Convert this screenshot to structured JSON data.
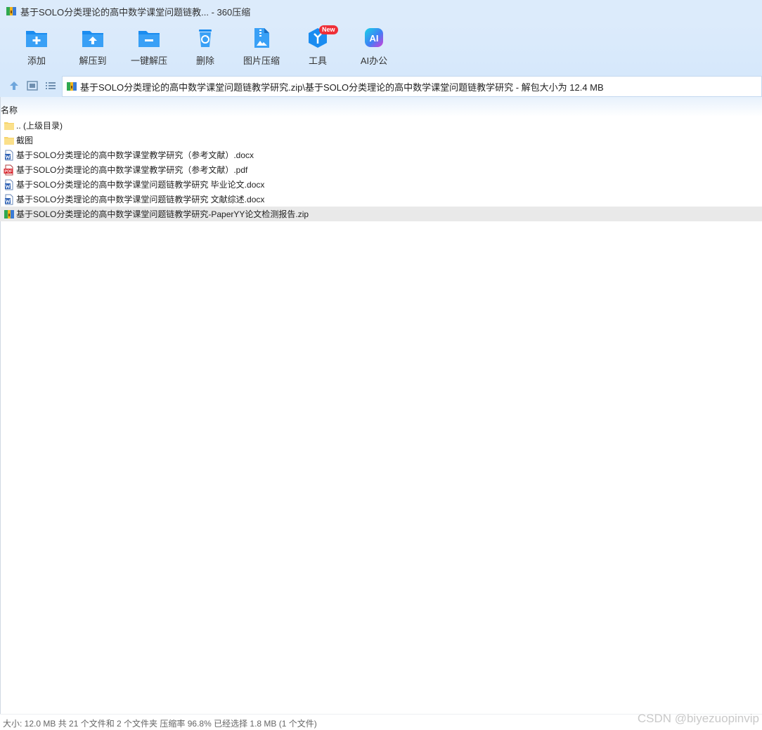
{
  "window": {
    "title": "基于SOLO分类理论的高中数学课堂问题链教... - 360压缩"
  },
  "toolbar": {
    "buttons": [
      {
        "label": "添加",
        "icon": "add-icon"
      },
      {
        "label": "解压到",
        "icon": "extract-to-icon"
      },
      {
        "label": "一键解压",
        "icon": "one-click-extract-icon"
      },
      {
        "label": "删除",
        "icon": "recycle-bin-icon"
      },
      {
        "label": "图片压缩",
        "icon": "image-compress-icon"
      },
      {
        "label": "工具",
        "icon": "tools-icon",
        "badge": "New"
      },
      {
        "label": "AI办公",
        "icon": "ai-office-icon",
        "icon_text": "AI"
      }
    ]
  },
  "nav": {
    "address": "基于SOLO分类理论的高中数学课堂问题链教学研究.zip\\基于SOLO分类理论的高中数学课堂问题链教学研究 - 解包大小为 12.4 MB"
  },
  "columns": {
    "name": "名称"
  },
  "files": [
    {
      "name": ".. (上级目录)",
      "type": "folder"
    },
    {
      "name": "截图",
      "type": "folder"
    },
    {
      "name": "基于SOLO分类理论的高中数学课堂教学研究（参考文献）.docx",
      "type": "word"
    },
    {
      "name": "基于SOLO分类理论的高中数学课堂教学研究（参考文献）.pdf",
      "type": "pdf",
      "icon_text": "PDF"
    },
    {
      "name": "基于SOLO分类理论的高中数学课堂问题链教学研究 毕业论文.docx",
      "type": "word"
    },
    {
      "name": "基于SOLO分类理论的高中数学课堂问题链教学研究 文献综述.docx",
      "type": "word"
    },
    {
      "name": "基于SOLO分类理论的高中数学课堂问题链教学研究-PaperYY论文检测报告.zip",
      "type": "zip",
      "selected": true
    }
  ],
  "status": {
    "text": "大小: 12.0 MB 共 21 个文件和 2 个文件夹 压缩率 96.8% 已经选择 1.8 MB (1 个文件)"
  },
  "watermark": "CSDN @biyezuopinvip",
  "colors": {
    "toolbar_bg": "#dcebfb",
    "icon_blue": "#1a8cf0",
    "badge_red": "#ef2f37",
    "selected_row": "#e9e9e9"
  }
}
